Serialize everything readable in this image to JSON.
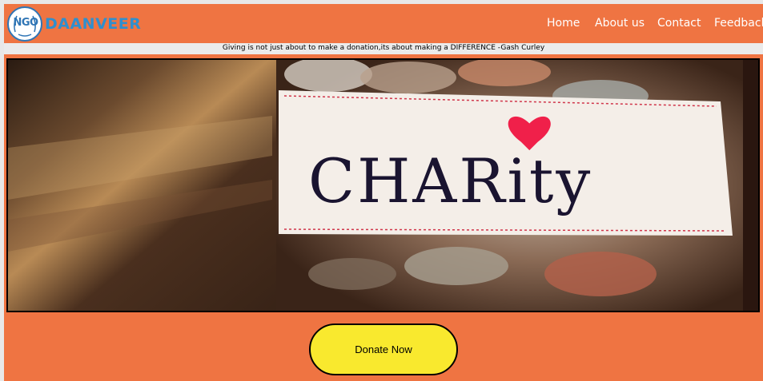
{
  "header": {
    "logo_text": "NGO",
    "brand": "DAANVEER",
    "nav": [
      "Home",
      "About us",
      "Contact",
      "Feedback"
    ]
  },
  "quote": "Giving is not just about to make a donation,its about making a DIFFERENCE -Gash Curley",
  "hero": {
    "label_text": "CHARity"
  },
  "donate_button": "Donate Now",
  "colors": {
    "page_bg": "#ef7442",
    "brand": "#2f8fce",
    "button": "#f9e92e",
    "heart": "#f0204a"
  }
}
